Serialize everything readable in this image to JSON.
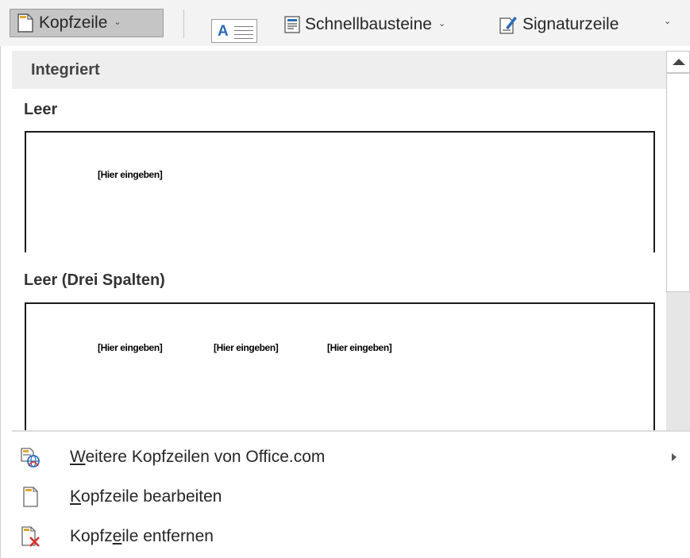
{
  "ribbon": {
    "header_button": "Kopfzeile",
    "quick_parts_label": "Schnellbausteine",
    "signature_line_label": "Signaturzeile",
    "text_box_letter": "A",
    "icons": {
      "header": "header-page-icon",
      "textbox": "textbox-icon",
      "quick_parts": "quick-parts-icon",
      "signature": "signature-line-icon",
      "chevron": "chevron-down-icon"
    }
  },
  "gallery": {
    "category": "Integriert",
    "items": [
      {
        "title": "Leer",
        "placeholders": [
          "[Hier eingeben]"
        ]
      },
      {
        "title": "Leer (Drei Spalten)",
        "placeholders": [
          "[Hier eingeben]",
          "[Hier eingeben]",
          "[Hier eingeben]"
        ]
      }
    ]
  },
  "menu": {
    "items": [
      {
        "label": "Weitere Kopfzeilen von Office.com",
        "accelerator": "W",
        "icon": "office-com-headers-icon",
        "has_submenu": true
      },
      {
        "label": "Kopfzeile bearbeiten",
        "accelerator": "K",
        "icon": "edit-header-icon",
        "has_submenu": false
      },
      {
        "label": "Kopfzeile entfernen",
        "accelerator": "e",
        "icon": "remove-header-icon",
        "has_submenu": false
      }
    ]
  },
  "colors": {
    "ribbon_bg": "#f3f3f3",
    "pressed_bg": "#c5c5c5",
    "category_bg": "#eeeeee",
    "accent_blue": "#2b6cb8",
    "remove_red": "#d9302b"
  }
}
